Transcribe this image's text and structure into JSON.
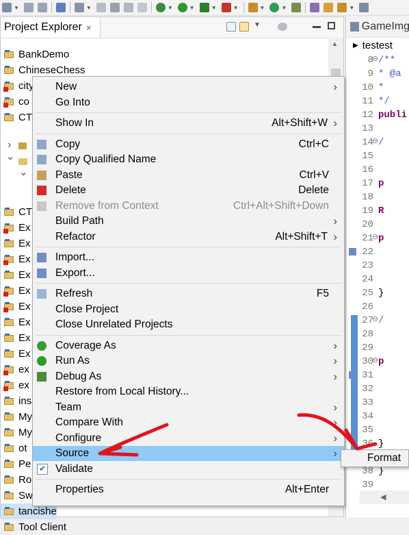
{
  "project_explorer": {
    "tab_title": "Project Explorer",
    "close_glyph": "×",
    "items": [
      {
        "label": "BankDemo",
        "error": false,
        "y": 0
      },
      {
        "label": "ChineseChess",
        "error": false
      },
      {
        "label": "city",
        "error": true
      },
      {
        "label": "co",
        "error": true
      },
      {
        "label": "CT",
        "error": false
      },
      {
        "label": "",
        "error": false
      },
      {
        "label": "",
        "error": false
      },
      {
        "label": "",
        "error": false
      },
      {
        "label": "",
        "error": false
      },
      {
        "label": "",
        "error": false
      },
      {
        "label": "CT",
        "error": false
      },
      {
        "label": "Ex",
        "error": true
      },
      {
        "label": "Ex",
        "error": false
      },
      {
        "label": "Ex",
        "error": true
      },
      {
        "label": "Ex",
        "error": false
      },
      {
        "label": "Ex",
        "error": true
      },
      {
        "label": "Ex",
        "error": true
      },
      {
        "label": "Ex",
        "error": false
      },
      {
        "label": "Ex",
        "error": false
      },
      {
        "label": "Ex",
        "error": false
      },
      {
        "label": "ex",
        "error": true
      },
      {
        "label": "ex",
        "error": true
      },
      {
        "label": "ins",
        "error": false
      },
      {
        "label": "My",
        "error": false
      },
      {
        "label": "My",
        "error": false
      },
      {
        "label": "ot",
        "error": false
      },
      {
        "label": "Pe",
        "error": false
      },
      {
        "label": "Ro",
        "error": false
      },
      {
        "label": "Sw",
        "error": false
      },
      {
        "label": "tancishe",
        "error": false
      },
      {
        "label": "Tool Client",
        "error": false
      }
    ]
  },
  "editor": {
    "tab_title": "GameImg",
    "breadcrumb": "testest",
    "lines": [
      {
        "n": "8",
        "code": "/**",
        "fold": true
      },
      {
        "n": "9",
        "code": " * @a"
      },
      {
        "n": "10",
        "code": " *"
      },
      {
        "n": "11",
        "code": " */"
      },
      {
        "n": "12",
        "code": "publi"
      },
      {
        "n": "13",
        "code": ""
      },
      {
        "n": "14",
        "code": "   /",
        "fold": true
      },
      {
        "n": "15",
        "code": ""
      },
      {
        "n": "16",
        "code": ""
      },
      {
        "n": "17",
        "code": "   p"
      },
      {
        "n": "18",
        "code": ""
      },
      {
        "n": "19",
        "code": "   R"
      },
      {
        "n": "20",
        "code": ""
      },
      {
        "n": "21",
        "code": "   p",
        "fold": true
      },
      {
        "n": "22",
        "code": ""
      },
      {
        "n": "23",
        "code": ""
      },
      {
        "n": "24",
        "code": ""
      },
      {
        "n": "25",
        "code": "   }"
      },
      {
        "n": "26",
        "code": ""
      },
      {
        "n": "27",
        "code": "   /",
        "fold": true
      },
      {
        "n": "28",
        "code": ""
      },
      {
        "n": "29",
        "code": ""
      },
      {
        "n": "30",
        "code": "   p",
        "fold": true
      },
      {
        "n": "31",
        "code": ""
      },
      {
        "n": "32",
        "code": ""
      },
      {
        "n": "33",
        "code": ""
      },
      {
        "n": "34",
        "code": ""
      },
      {
        "n": "35",
        "code": ""
      },
      {
        "n": "36",
        "code": "   }"
      },
      {
        "n": "37",
        "code": ""
      },
      {
        "n": "38",
        "code": "}"
      },
      {
        "n": "39",
        "code": ""
      }
    ]
  },
  "context_menu": {
    "items": [
      {
        "label": "New",
        "accel": "",
        "submenu": true
      },
      {
        "label": "Go Into",
        "accel": ""
      },
      {
        "sep": true
      },
      {
        "label": "Show In",
        "accel": "Alt+Shift+W",
        "submenu": true
      },
      {
        "sep": true
      },
      {
        "label": "Copy",
        "accel": "Ctrl+C",
        "icon": "copy-icon"
      },
      {
        "label": "Copy Qualified Name",
        "accel": "",
        "icon": "copy-qualified-icon"
      },
      {
        "label": "Paste",
        "accel": "Ctrl+V",
        "icon": "paste-icon"
      },
      {
        "label": "Delete",
        "accel": "Delete",
        "icon": "delete-icon"
      },
      {
        "label": "Remove from Context",
        "accel": "Ctrl+Alt+Shift+Down",
        "disabled": true,
        "icon": "remove-context-icon"
      },
      {
        "label": "Build Path",
        "accel": "",
        "submenu": true
      },
      {
        "label": "Refactor",
        "accel": "Alt+Shift+T",
        "submenu": true
      },
      {
        "sep": true
      },
      {
        "label": "Import...",
        "accel": "",
        "icon": "import-icon"
      },
      {
        "label": "Export...",
        "accel": "",
        "icon": "export-icon"
      },
      {
        "sep": true
      },
      {
        "label": "Refresh",
        "accel": "F5",
        "icon": "refresh-icon"
      },
      {
        "label": "Close Project",
        "accel": ""
      },
      {
        "label": "Close Unrelated Projects",
        "accel": ""
      },
      {
        "sep": true
      },
      {
        "label": "Coverage As",
        "accel": "",
        "submenu": true,
        "icon": "coverage-icon"
      },
      {
        "label": "Run As",
        "accel": "",
        "submenu": true,
        "icon": "run-icon"
      },
      {
        "label": "Debug As",
        "accel": "",
        "submenu": true,
        "icon": "debug-icon"
      },
      {
        "label": "Restore from Local History...",
        "accel": ""
      },
      {
        "label": "Team",
        "accel": "",
        "submenu": true
      },
      {
        "label": "Compare With",
        "accel": "",
        "submenu": true
      },
      {
        "label": "Configure",
        "accel": "",
        "submenu": true
      },
      {
        "label": "Source",
        "accel": "",
        "submenu": true,
        "highlighted": true
      },
      {
        "label": "Validate",
        "accel": "",
        "icon": "validate-check-icon"
      },
      {
        "sep": true
      },
      {
        "label": "Properties",
        "accel": "Alt+Enter"
      }
    ]
  },
  "submenu": {
    "label": "Format"
  },
  "colors": {
    "highlight": "#91c9f7",
    "annotation": "#e0141e"
  }
}
